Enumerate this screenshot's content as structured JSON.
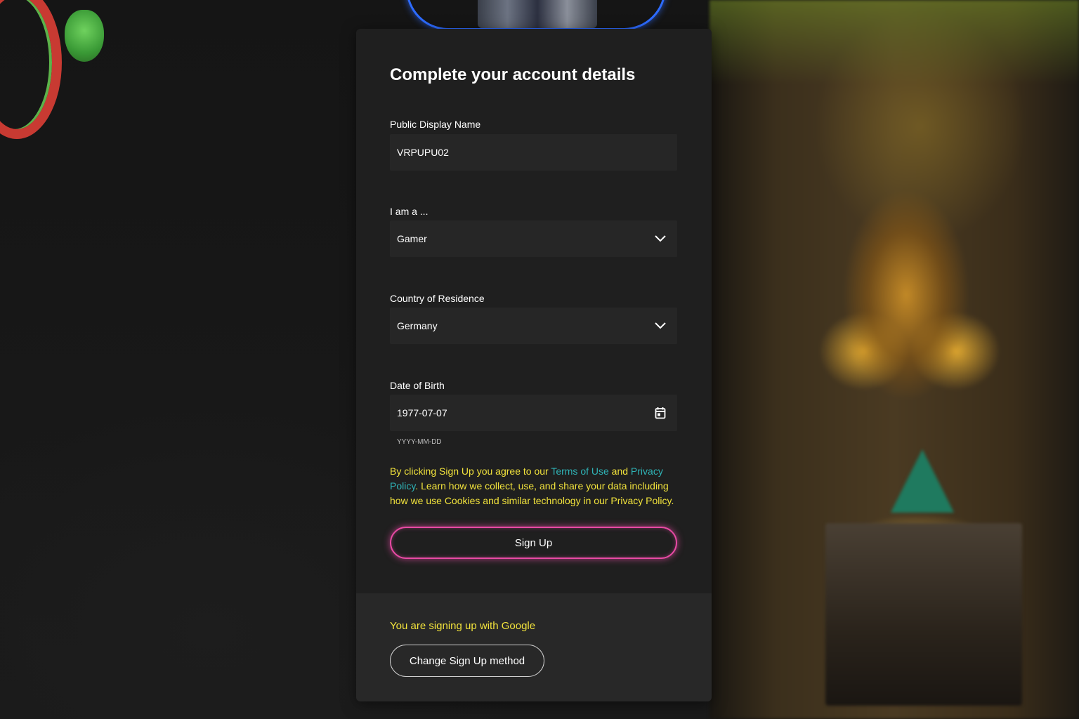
{
  "form": {
    "title": "Complete your account details",
    "display_name": {
      "label": "Public Display Name",
      "value": "VRPUPU02"
    },
    "role": {
      "label": "I am a ...",
      "value": "Gamer",
      "icon": "chevron-down-icon"
    },
    "country": {
      "label": "Country of Residence",
      "value": "Germany",
      "icon": "chevron-down-icon"
    },
    "dob": {
      "label": "Date of Birth",
      "value": "1977-07-07",
      "helper": "YYYY-MM-DD",
      "icon": "calendar-icon"
    },
    "legal": {
      "part1": "By clicking Sign Up you agree to our ",
      "terms_link": "Terms of Use",
      "part2": " and ",
      "privacy_link": "Privacy Policy",
      "part3": ". Learn how we collect, use, and share your data including how we use Cookies and similar technology in our Privacy Policy."
    },
    "signup_label": "Sign Up"
  },
  "footer": {
    "google_note": "You are signing up with Google",
    "change_label": "Change Sign Up method"
  },
  "colors": {
    "accent_yellow": "#f2e33c",
    "link_teal": "#2fb3b6",
    "button_glow_pink": "#e84aa4",
    "avatar_ring_blue": "#2d6bff"
  }
}
